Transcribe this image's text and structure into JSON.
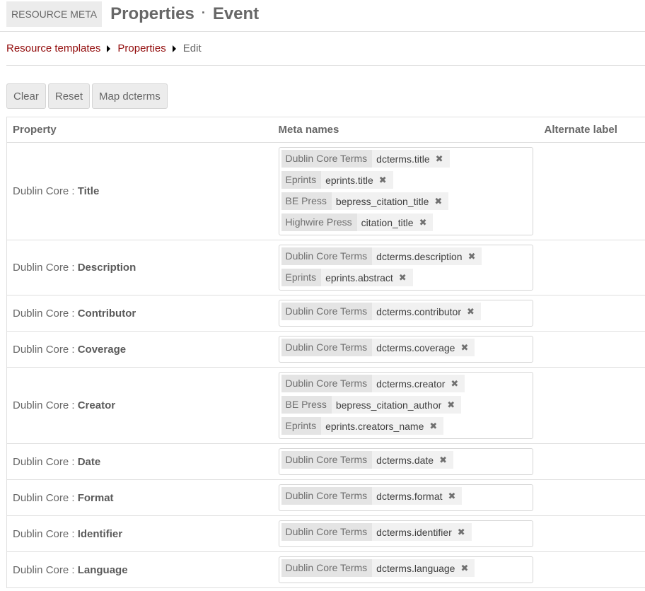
{
  "header": {
    "module": "RESOURCE META",
    "title": "Properties",
    "separator": "·",
    "subtitle": "Event"
  },
  "breadcrumb": {
    "items": [
      {
        "label": "Resource templates",
        "link": true
      },
      {
        "label": "Properties",
        "link": true
      },
      {
        "label": "Edit",
        "link": false
      }
    ]
  },
  "toolbar": {
    "clear_label": "Clear",
    "reset_label": "Reset",
    "map_label": "Map dcterms"
  },
  "table": {
    "headers": {
      "property": "Property",
      "meta_names": "Meta names",
      "alternate_label": "Alternate label"
    },
    "rows": [
      {
        "vocab": "Dublin Core :",
        "property": "Title",
        "tags": [
          {
            "vocab": "Dublin Core Terms",
            "term": "dcterms.title"
          },
          {
            "vocab": "Eprints",
            "term": "eprints.title"
          },
          {
            "vocab": "BE Press",
            "term": "bepress_citation_title"
          },
          {
            "vocab": "Highwire Press",
            "term": "citation_title"
          }
        ],
        "alternate_label": ""
      },
      {
        "vocab": "Dublin Core :",
        "property": "Description",
        "tags": [
          {
            "vocab": "Dublin Core Terms",
            "term": "dcterms.description"
          },
          {
            "vocab": "Eprints",
            "term": "eprints.abstract"
          }
        ],
        "alternate_label": ""
      },
      {
        "vocab": "Dublin Core :",
        "property": "Contributor",
        "tags": [
          {
            "vocab": "Dublin Core Terms",
            "term": "dcterms.contributor"
          }
        ],
        "alternate_label": ""
      },
      {
        "vocab": "Dublin Core :",
        "property": "Coverage",
        "tags": [
          {
            "vocab": "Dublin Core Terms",
            "term": "dcterms.coverage"
          }
        ],
        "alternate_label": ""
      },
      {
        "vocab": "Dublin Core :",
        "property": "Creator",
        "tags": [
          {
            "vocab": "Dublin Core Terms",
            "term": "dcterms.creator"
          },
          {
            "vocab": "BE Press",
            "term": "bepress_citation_author"
          },
          {
            "vocab": "Eprints",
            "term": "eprints.creators_name"
          }
        ],
        "alternate_label": ""
      },
      {
        "vocab": "Dublin Core :",
        "property": "Date",
        "tags": [
          {
            "vocab": "Dublin Core Terms",
            "term": "dcterms.date"
          }
        ],
        "alternate_label": ""
      },
      {
        "vocab": "Dublin Core :",
        "property": "Format",
        "tags": [
          {
            "vocab": "Dublin Core Terms",
            "term": "dcterms.format"
          }
        ],
        "alternate_label": ""
      },
      {
        "vocab": "Dublin Core :",
        "property": "Identifier",
        "tags": [
          {
            "vocab": "Dublin Core Terms",
            "term": "dcterms.identifier"
          }
        ],
        "alternate_label": ""
      },
      {
        "vocab": "Dublin Core :",
        "property": "Language",
        "tags": [
          {
            "vocab": "Dublin Core Terms",
            "term": "dcterms.language"
          }
        ],
        "alternate_label": ""
      }
    ],
    "remove_glyph": "✖"
  },
  "colors": {
    "link": "#920b0b",
    "text": "#676767",
    "button_bg": "#ececec",
    "tag_vocab_bg": "#e4e4e4",
    "tag_bg": "#f1f1f1",
    "border": "#dfdfdf"
  }
}
